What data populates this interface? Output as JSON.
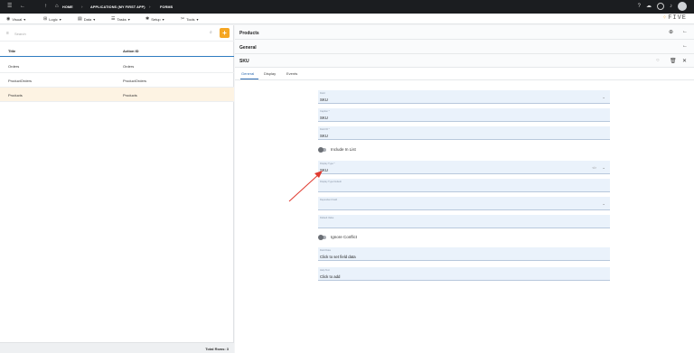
{
  "topbar": {
    "home": "HOME",
    "applications": "APPLICATIONS (MY FIRST APP)",
    "forms": "FORMS",
    "icons": [
      "menu-icon",
      "back-icon",
      "up-icon",
      "home-icon",
      "help-icon",
      "cloud-icon",
      "settings-icon",
      "notification-icon",
      "avatar"
    ]
  },
  "menubar": {
    "items": [
      {
        "label": "Visual",
        "icon": "eye-icon"
      },
      {
        "label": "Logic",
        "icon": "logic-icon"
      },
      {
        "label": "Data",
        "icon": "data-icon"
      },
      {
        "label": "Tasks",
        "icon": "tasks-icon"
      },
      {
        "label": "Setup",
        "icon": "setup-icon"
      },
      {
        "label": "Tools",
        "icon": "tools-icon"
      }
    ],
    "logo": "FIVE"
  },
  "list": {
    "search_placeholder": "Search",
    "columns": [
      "Title",
      "Action ID"
    ],
    "rows": [
      {
        "title": "Orders",
        "action": "Orders"
      },
      {
        "title": "ProductOrders",
        "action": "ProductOrders"
      },
      {
        "title": "Products",
        "action": "Products"
      }
    ],
    "footer": "Total Rows: 3"
  },
  "detail": {
    "title": "Products",
    "section": "General",
    "subtitle": "SKU",
    "tabs": [
      "General",
      "Display",
      "Events"
    ],
    "fields": {
      "field": {
        "label": "Field",
        "value": "SKU"
      },
      "caption": {
        "label": "Caption *",
        "value": "SKU"
      },
      "field_id": {
        "label": "Field ID *",
        "value": "SKU"
      },
      "include_in_list": "Include In List",
      "display_type": {
        "label": "Display Type *",
        "value": "SKU",
        "code": "</>"
      },
      "display_type_default": {
        "label": "Display Type Default",
        "value": ""
      },
      "dependent_field": {
        "label": "Dependent Field",
        "value": ""
      },
      "default_value": {
        "label": "Default Value",
        "value": ""
      },
      "ignore_conflict": "Ignore Conflict",
      "field_data": {
        "label": "Field Data",
        "value": "Click to set field data"
      },
      "help_text": {
        "label": "Help Text",
        "value": "Click to add"
      }
    }
  },
  "colors": {
    "accent": "#f5a623",
    "link": "#2f6db3",
    "arrow": "#e03a2f"
  }
}
